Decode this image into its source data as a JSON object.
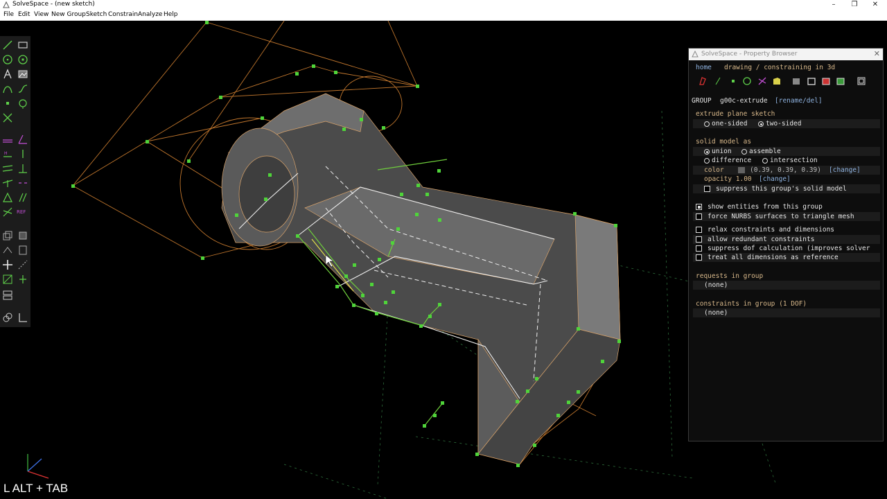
{
  "window": {
    "title": "SolveSpace - (new sketch)",
    "controls": [
      "–",
      "❐",
      "✕"
    ]
  },
  "menu": [
    "File",
    "Edit",
    "View",
    "New Group",
    "Sketch",
    "Constrain",
    "Analyze",
    "Help"
  ],
  "toolbar": {
    "tools": [
      "line-icon",
      "rectangle-icon",
      "circle-icon",
      "arc-icon",
      "text-icon",
      "image-icon",
      "bezier-icon",
      "spline-icon",
      "point-icon",
      "workplane-icon",
      "split-icon",
      "distance-constraint-icon",
      "angle-constraint-icon",
      "horizontal-constraint-icon",
      "vertical-constraint-icon",
      "parallel-constraint-icon",
      "perpendicular-constraint-icon",
      "on-point-constraint-icon",
      "symmetric-constraint-icon",
      "equal-constraint-icon",
      "midpoint-constraint-icon",
      "tangent-constraint-icon",
      "reference-constraint-icon",
      "extrude-icon",
      "lathe-icon",
      "revolve-icon",
      "helix-icon",
      "step-translate-icon",
      "step-rotate-icon",
      "workplane-new-icon",
      "sketch-in-3d-icon",
      "link-icon",
      "nearest-view-icon",
      "assemble-icon",
      "ortho-icon"
    ],
    "ref_label": "REF"
  },
  "browser": {
    "title": "SolveSpace - Property Browser",
    "nav_home": "home",
    "nav_path": "drawing / constraining in 3d",
    "group_label": "GROUP",
    "group_name": "g00c-extrude",
    "group_action": "[rename/del]",
    "extrude_heading": "extrude plane sketch",
    "extrude_options": {
      "one_sided": "one-sided",
      "two_sided": "two-sided"
    },
    "solid_heading": "solid model as",
    "solid_options": {
      "union": "union",
      "assemble": "assemble",
      "difference": "difference",
      "intersection": "intersection"
    },
    "color_label": "color",
    "color_value": "(0.39, 0.39, 0.39)",
    "color_change": "[change]",
    "opacity_label": "opacity 1.00",
    "opacity_change": "[change]",
    "suppress_solid": "suppress this group's solid model",
    "show_entities": "show entities from this group",
    "force_nurbs": "force NURBS surfaces to triangle mesh",
    "relax": "relax constraints and dimensions",
    "allow_redundant": "allow redundant constraints",
    "suppress_dof": "suppress dof calculation (improves solver",
    "treat_ref": "treat all dimensions as reference",
    "requests_heading": "requests in group",
    "requests_value": "(none)",
    "constraints_heading": "constraints in group (1 DOF)",
    "constraints_value": "(none)",
    "swatch_color": "#636363"
  },
  "overlay": "L ALT  +  TAB"
}
